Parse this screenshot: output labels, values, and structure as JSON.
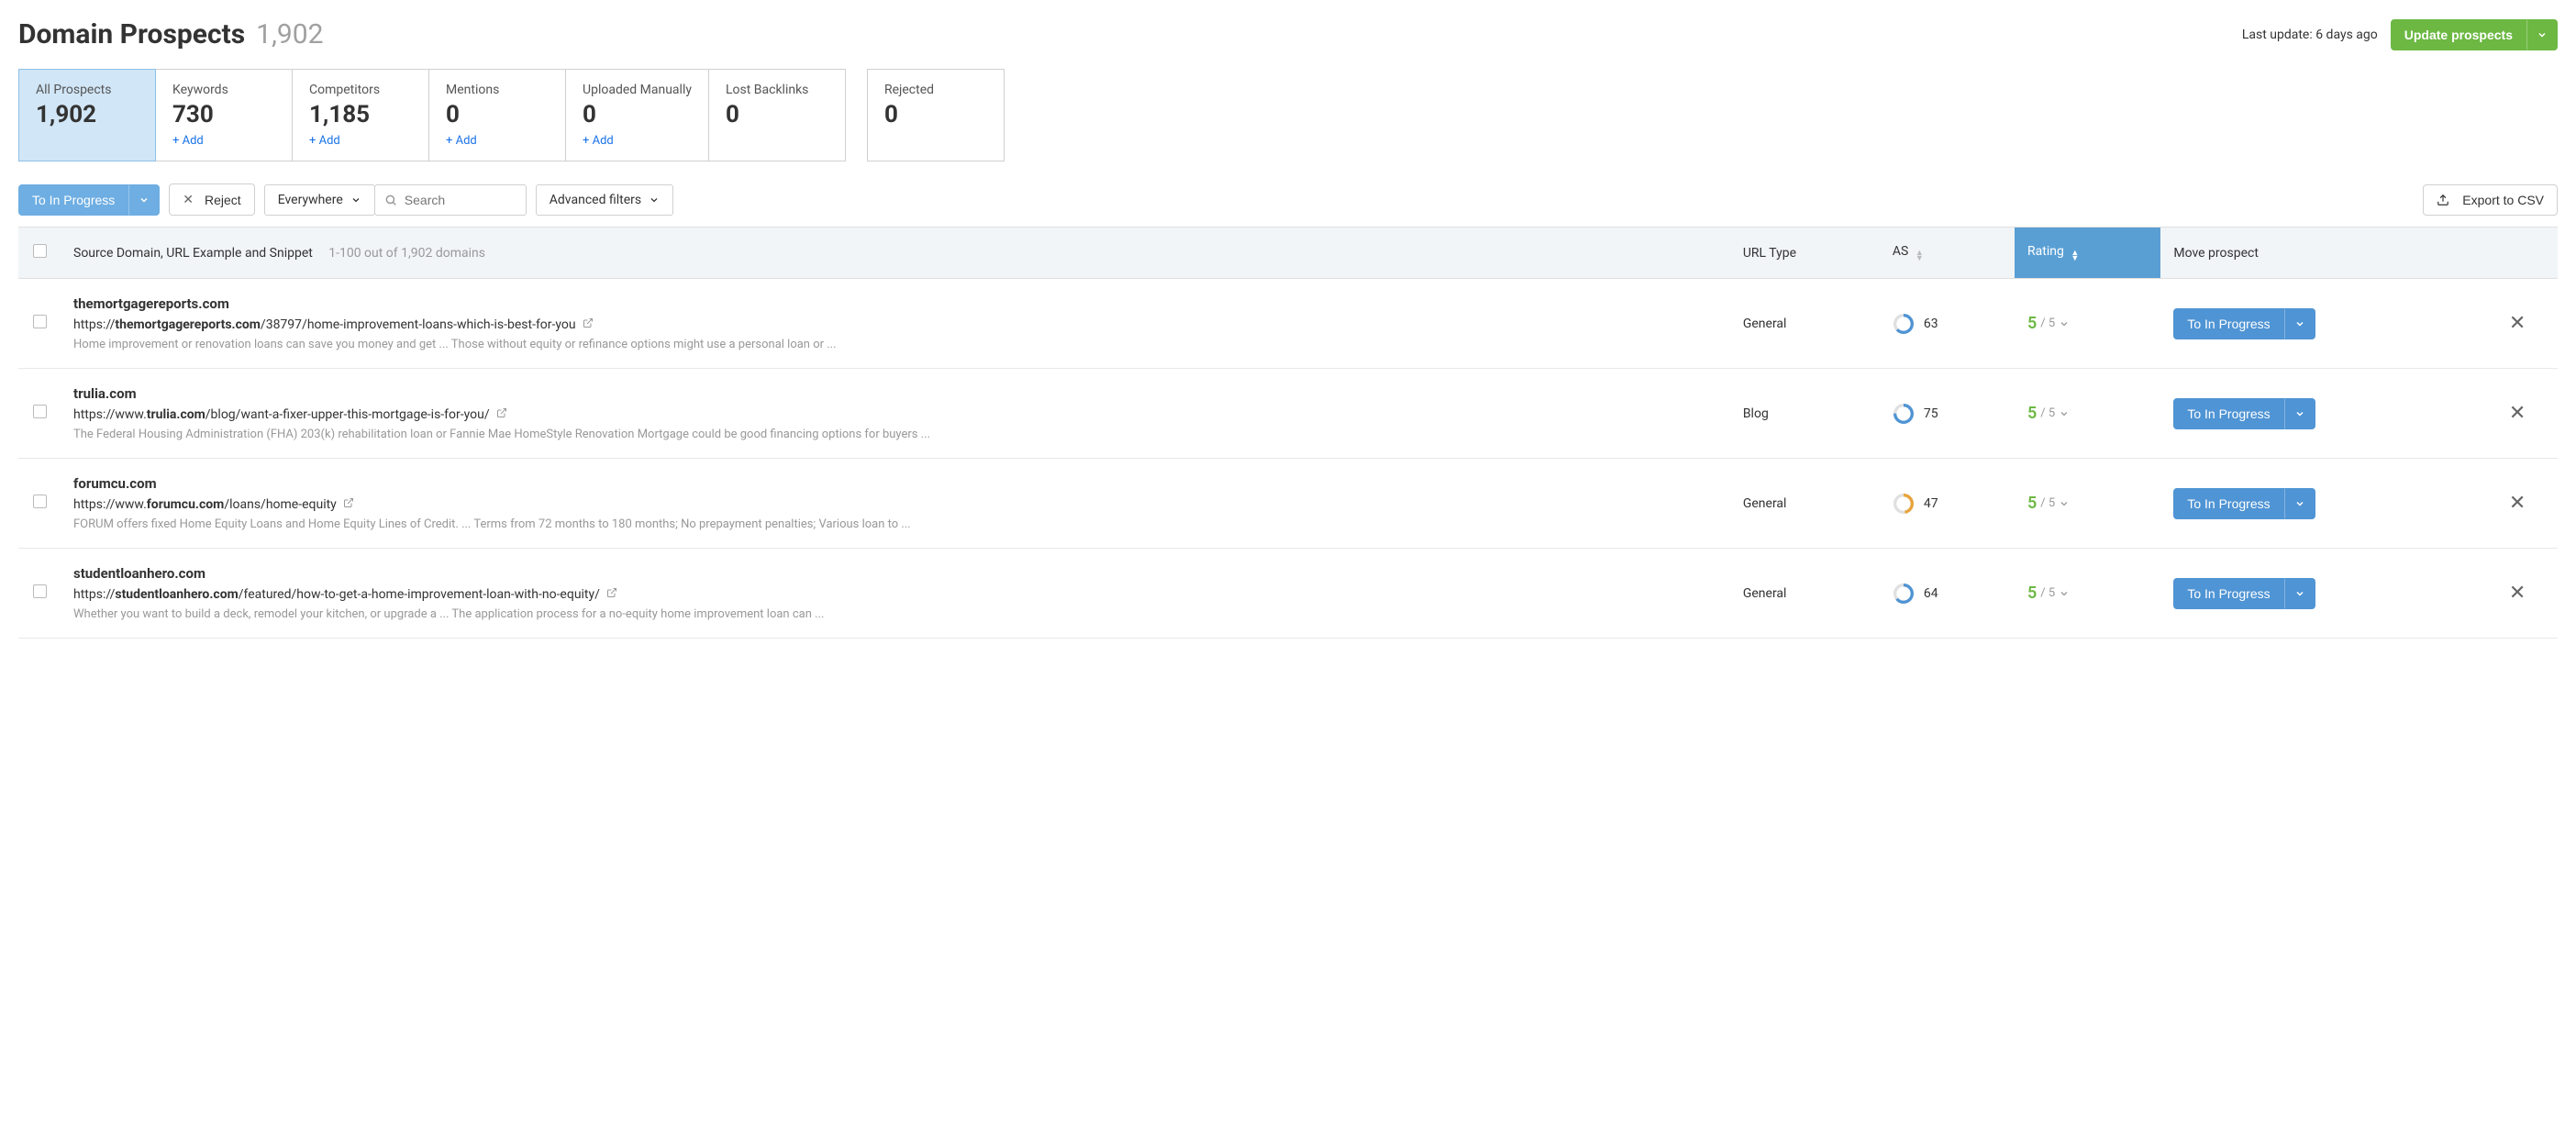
{
  "header": {
    "title": "Domain Prospects",
    "count": "1,902",
    "last_update": "Last update: 6 days ago",
    "update_btn": "Update prospects"
  },
  "cards": [
    {
      "label": "All Prospects",
      "value": "1,902",
      "add": null,
      "active": true
    },
    {
      "label": "Keywords",
      "value": "730",
      "add": "+ Add",
      "active": false
    },
    {
      "label": "Competitors",
      "value": "1,185",
      "add": "+ Add",
      "active": false
    },
    {
      "label": "Mentions",
      "value": "0",
      "add": "+ Add",
      "active": false
    },
    {
      "label": "Uploaded Manually",
      "value": "0",
      "add": "+ Add",
      "active": false
    },
    {
      "label": "Lost Backlinks",
      "value": "0",
      "add": null,
      "active": false
    },
    {
      "label": "Rejected",
      "value": "0",
      "add": null,
      "active": false,
      "gap_before": true
    }
  ],
  "toolbar": {
    "to_in_progress": "To In Progress",
    "reject": "Reject",
    "everywhere": "Everywhere",
    "search_placeholder": "Search",
    "adv_filters": "Advanced filters",
    "export": "Export to CSV"
  },
  "table": {
    "col_source": "Source Domain, URL Example and Snippet",
    "col_source_sub": "1-100 out of 1,902 domains",
    "col_urltype": "URL Type",
    "col_as": "AS",
    "col_rating": "Rating",
    "col_move": "Move prospect",
    "row_btn": "To In Progress"
  },
  "rows": [
    {
      "domain": "themortgagereports.com",
      "url_pre": "https://",
      "url_bold": "themortgagereports.com",
      "url_post": "/38797/home-improvement-loans-which-is-best-for-you",
      "snippet": "Home improvement or renovation loans can save you money and get ... Those without equity or refinance options might use a personal loan or ...",
      "url_type": "General",
      "as": "63",
      "ring_color": "#4f94d4",
      "rating_big": "5",
      "rating_small": "/ 5"
    },
    {
      "domain": "trulia.com",
      "url_pre": "https://www.",
      "url_bold": "trulia.com",
      "url_post": "/blog/want-a-fixer-upper-this-mortgage-is-for-you/",
      "snippet": "The Federal Housing Administration (FHA) 203(k) rehabilitation loan or Fannie Mae HomeStyle Renovation Mortgage could be good financing options for buyers ...",
      "url_type": "Blog",
      "as": "75",
      "ring_color": "#4f94d4",
      "rating_big": "5",
      "rating_small": "/ 5"
    },
    {
      "domain": "forumcu.com",
      "url_pre": "https://www.",
      "url_bold": "forumcu.com",
      "url_post": "/loans/home-equity",
      "snippet": "FORUM offers fixed Home Equity Loans and Home Equity Lines of Credit. ... Terms from 72 months to 180 months; No prepayment penalties; Various loan to ...",
      "url_type": "General",
      "as": "47",
      "ring_color": "#e8a33d",
      "rating_big": "5",
      "rating_small": "/ 5"
    },
    {
      "domain": "studentloanhero.com",
      "url_pre": "https://",
      "url_bold": "studentloanhero.com",
      "url_post": "/featured/how-to-get-a-home-improvement-loan-with-no-equity/",
      "snippet": "Whether you want to build a deck, remodel your kitchen, or upgrade a ... The application process for a no-equity home improvement loan can ...",
      "url_type": "General",
      "as": "64",
      "ring_color": "#4f94d4",
      "rating_big": "5",
      "rating_small": "/ 5"
    }
  ]
}
